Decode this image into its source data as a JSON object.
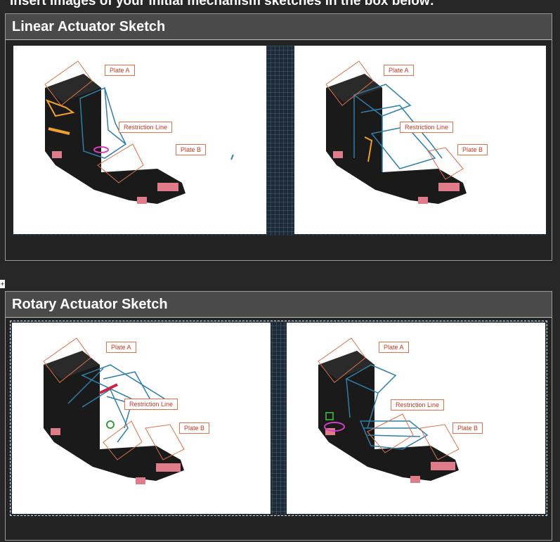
{
  "instruction": "Insert images of your initial mechanism sketches in the box below:",
  "sections": [
    {
      "title": "Linear Actuator Sketch",
      "sketches": [
        {
          "labels": {
            "plate_a": "Plate A",
            "restriction": "Restriction Line",
            "plate_b": "Plate B"
          }
        },
        {
          "labels": {
            "plate_a": "Plate A",
            "restriction": "Restriction Line",
            "plate_b": "Plate B"
          }
        }
      ]
    },
    {
      "title": "Rotary Actuator Sketch",
      "sketches": [
        {
          "labels": {
            "plate_a": "Plate A",
            "restriction": "Restriction Line",
            "plate_b": "Plate B"
          }
        },
        {
          "labels": {
            "plate_a": "Plate A",
            "restriction": "Restriction Line",
            "plate_b": "Plate B"
          }
        }
      ]
    }
  ],
  "colors": {
    "background": "#272727",
    "header": "#4a4a4a",
    "sketch_line": "#2f7fa8",
    "label_border": "#d9734a",
    "label_text": "#c0392b",
    "device_body": "#1a1a1a",
    "pink_block": "#e07c8a"
  }
}
